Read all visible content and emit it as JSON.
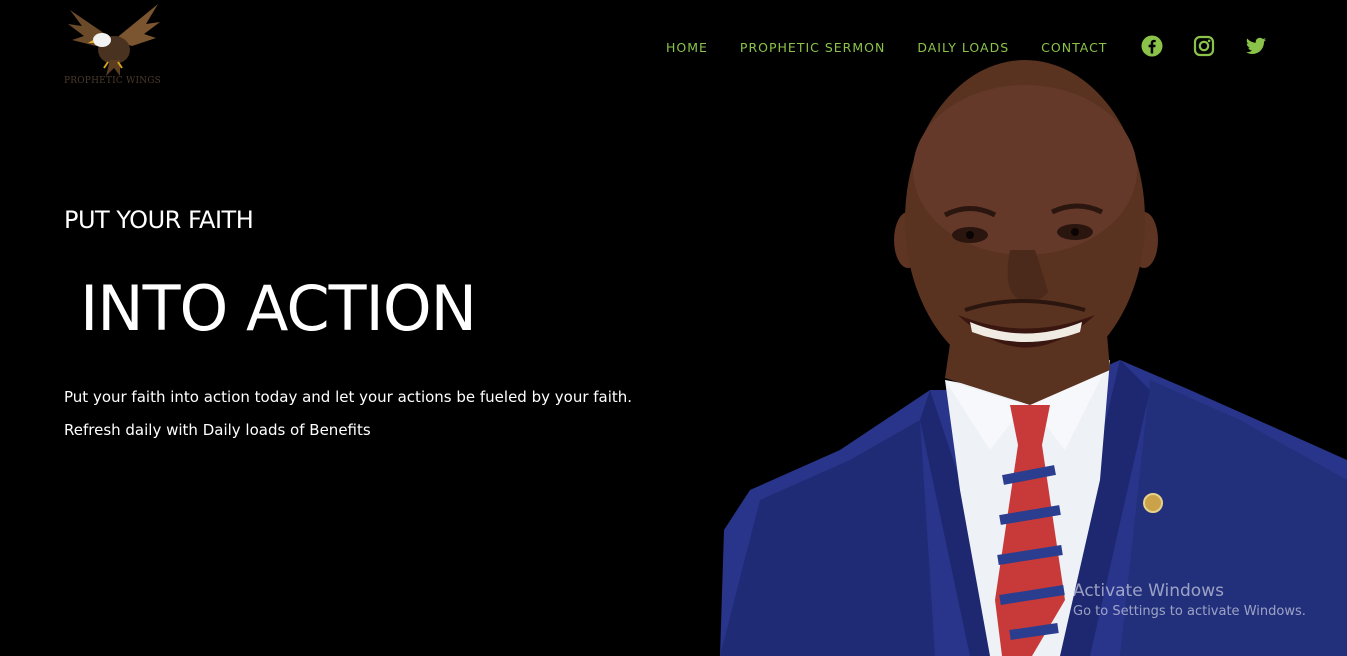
{
  "brand": {
    "logo_text": "PROPHETIC WINGS",
    "logo_icon": "eagle-icon"
  },
  "nav": {
    "items": [
      {
        "label": "HOME"
      },
      {
        "label": "PROPHETIC SERMON"
      },
      {
        "label": "DAILY LOADS"
      },
      {
        "label": "CONTACT"
      }
    ],
    "social": [
      {
        "icon": "facebook-icon"
      },
      {
        "icon": "instagram-icon"
      },
      {
        "icon": "twitter-icon"
      }
    ],
    "accent_color": "#8bc34a"
  },
  "hero": {
    "subtitle": "PUT YOUR FAITH",
    "title": "INTO ACTION",
    "line1": "Put your faith into action today and let your actions be fueled by your faith.",
    "line2": "Refresh daily with Daily loads of Benefits",
    "background_color": "#000000"
  },
  "watermark": {
    "title": "Activate Windows",
    "subtitle": "Go to Settings to activate Windows."
  }
}
